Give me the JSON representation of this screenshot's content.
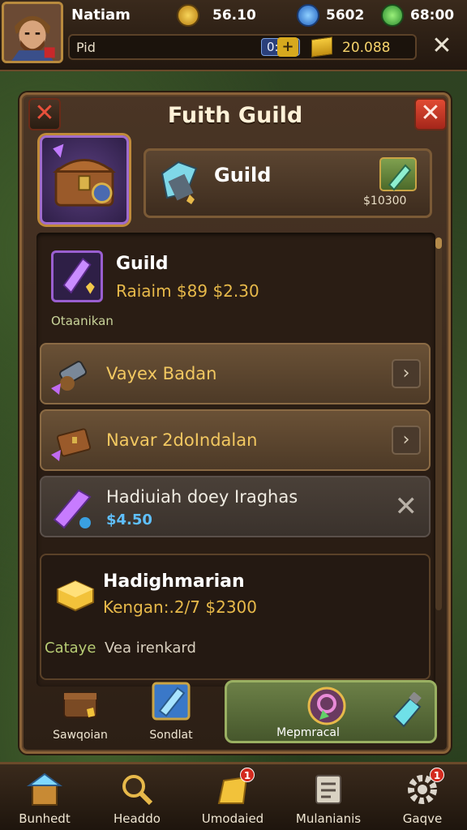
{
  "hud": {
    "player_name": "Natiam",
    "gold_coins": "56.10",
    "gems": "5602",
    "energy": "68:00",
    "bar_label": "Pid",
    "bar_badge": "0:27",
    "gold_bars": "20.088",
    "colors": {
      "gold": "#e7b94a",
      "gem": "#3c8ff0",
      "energy": "#43c04b"
    }
  },
  "panel": {
    "title": "Fuith Guild",
    "featured": {
      "title": "Guild",
      "price": "$10300"
    },
    "top_item": {
      "title": "Guild",
      "price": "Raiaim $89  $2.30",
      "subtitle": "Otaanikan"
    },
    "rows": [
      {
        "label": "Vayex Badan",
        "action_icon": "chevron-right-icon"
      },
      {
        "label": "Navar 2doIndalan",
        "action_icon": "chevron-right-icon"
      },
      {
        "label": "Hadiuiah doey Iraghas",
        "price": "$4.50",
        "action_icon": "close-icon"
      }
    ],
    "detail": {
      "title": "Hadighmarian",
      "price": "Kengan:.2/7  $2300",
      "tag": "Cataye",
      "description": "Vea irenkard"
    },
    "actions": [
      {
        "label": "Sawqoian",
        "icon": "chest-icon"
      },
      {
        "label": "Sondlat",
        "icon": "crystal-icon"
      },
      {
        "label": "Mepmracal",
        "icon": "potion-icon"
      }
    ]
  },
  "nav": [
    {
      "label": "Bunhedt",
      "icon": "house-icon",
      "badge": ""
    },
    {
      "label": "Headdo",
      "icon": "magnifier-icon",
      "badge": ""
    },
    {
      "label": "Umodaied",
      "icon": "gold-bag-icon",
      "badge": "1"
    },
    {
      "label": "Mulanianis",
      "icon": "scroll-icon",
      "badge": ""
    },
    {
      "label": "Gaqve",
      "icon": "gear-icon",
      "badge": "1"
    }
  ]
}
